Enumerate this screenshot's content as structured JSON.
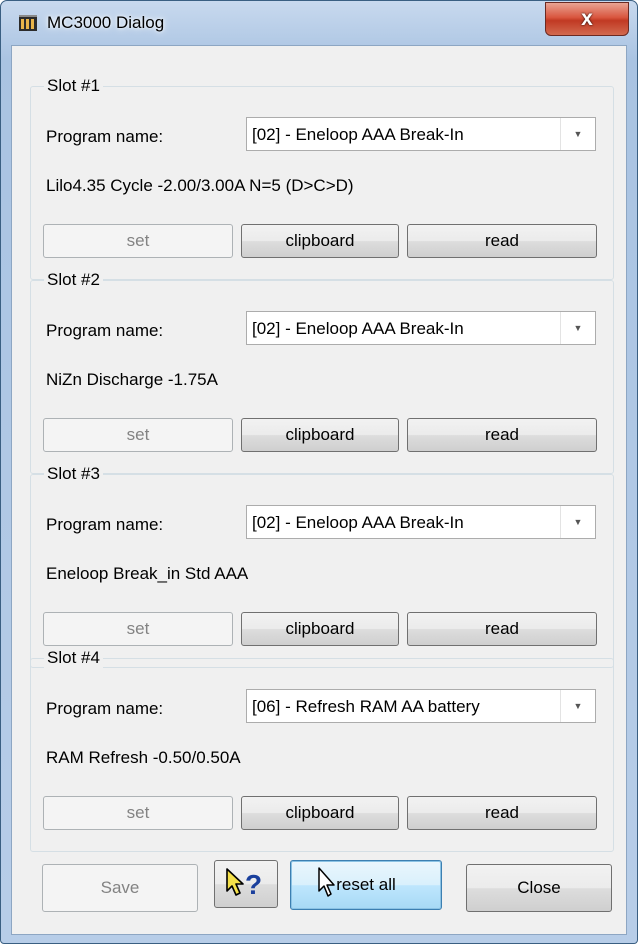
{
  "window": {
    "title": "MC3000 Dialog",
    "close_glyph": "x"
  },
  "slots": [
    {
      "title": "Slot #1",
      "program_label": "Program name:",
      "program_value": "[02] - Eneloop AAA Break-In",
      "description": "Lilo4.35  Cycle  -2.00/3.00A  N=5 (D>C>D)",
      "set_label": "set",
      "clipboard_label": "clipboard",
      "read_label": "read"
    },
    {
      "title": "Slot #2",
      "program_label": "Program name:",
      "program_value": "[02] - Eneloop AAA Break-In",
      "description": "NiZn  Discharge  -1.75A",
      "set_label": "set",
      "clipboard_label": "clipboard",
      "read_label": "read"
    },
    {
      "title": "Slot #3",
      "program_label": "Program name:",
      "program_value": "[02] - Eneloop AAA Break-In",
      "description": "Eneloop  Break_in  Std AAA",
      "set_label": "set",
      "clipboard_label": "clipboard",
      "read_label": "read"
    },
    {
      "title": "Slot #4",
      "program_label": "Program name:",
      "program_value": "[06] - Refresh RAM AA battery",
      "description": "RAM  Refresh  -0.50/0.50A",
      "set_label": "set",
      "clipboard_label": "clipboard",
      "read_label": "read"
    }
  ],
  "footer": {
    "save_label": "Save",
    "help_label": "?",
    "reset_label": "reset all",
    "close_label": "Close"
  },
  "icons": {
    "app": "app-icon",
    "help": "help-pointer-icon",
    "cursor": "mouse-pointer-icon",
    "dropdown": "chevron-down-icon"
  }
}
